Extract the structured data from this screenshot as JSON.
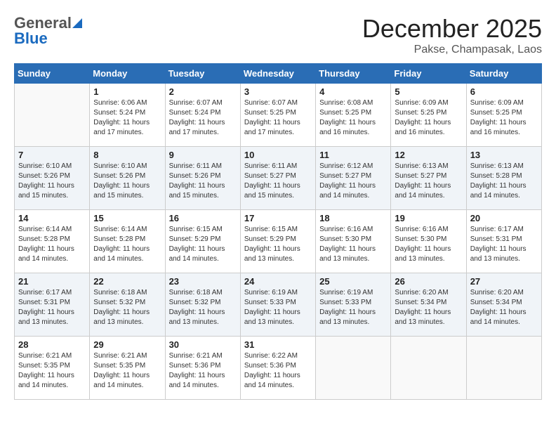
{
  "header": {
    "logo_general": "General",
    "logo_blue": "Blue",
    "title": "December 2025",
    "location": "Pakse, Champasak, Laos"
  },
  "days_of_week": [
    "Sunday",
    "Monday",
    "Tuesday",
    "Wednesday",
    "Thursday",
    "Friday",
    "Saturday"
  ],
  "weeks": [
    [
      {
        "day": "",
        "empty": true
      },
      {
        "day": "1",
        "sunrise": "6:06 AM",
        "sunset": "5:24 PM",
        "daylight": "11 hours and 17 minutes."
      },
      {
        "day": "2",
        "sunrise": "6:07 AM",
        "sunset": "5:24 PM",
        "daylight": "11 hours and 17 minutes."
      },
      {
        "day": "3",
        "sunrise": "6:07 AM",
        "sunset": "5:25 PM",
        "daylight": "11 hours and 17 minutes."
      },
      {
        "day": "4",
        "sunrise": "6:08 AM",
        "sunset": "5:25 PM",
        "daylight": "11 hours and 16 minutes."
      },
      {
        "day": "5",
        "sunrise": "6:09 AM",
        "sunset": "5:25 PM",
        "daylight": "11 hours and 16 minutes."
      },
      {
        "day": "6",
        "sunrise": "6:09 AM",
        "sunset": "5:25 PM",
        "daylight": "11 hours and 16 minutes."
      }
    ],
    [
      {
        "day": "7",
        "sunrise": "6:10 AM",
        "sunset": "5:26 PM",
        "daylight": "11 hours and 15 minutes."
      },
      {
        "day": "8",
        "sunrise": "6:10 AM",
        "sunset": "5:26 PM",
        "daylight": "11 hours and 15 minutes."
      },
      {
        "day": "9",
        "sunrise": "6:11 AM",
        "sunset": "5:26 PM",
        "daylight": "11 hours and 15 minutes."
      },
      {
        "day": "10",
        "sunrise": "6:11 AM",
        "sunset": "5:27 PM",
        "daylight": "11 hours and 15 minutes."
      },
      {
        "day": "11",
        "sunrise": "6:12 AM",
        "sunset": "5:27 PM",
        "daylight": "11 hours and 14 minutes."
      },
      {
        "day": "12",
        "sunrise": "6:13 AM",
        "sunset": "5:27 PM",
        "daylight": "11 hours and 14 minutes."
      },
      {
        "day": "13",
        "sunrise": "6:13 AM",
        "sunset": "5:28 PM",
        "daylight": "11 hours and 14 minutes."
      }
    ],
    [
      {
        "day": "14",
        "sunrise": "6:14 AM",
        "sunset": "5:28 PM",
        "daylight": "11 hours and 14 minutes."
      },
      {
        "day": "15",
        "sunrise": "6:14 AM",
        "sunset": "5:28 PM",
        "daylight": "11 hours and 14 minutes."
      },
      {
        "day": "16",
        "sunrise": "6:15 AM",
        "sunset": "5:29 PM",
        "daylight": "11 hours and 14 minutes."
      },
      {
        "day": "17",
        "sunrise": "6:15 AM",
        "sunset": "5:29 PM",
        "daylight": "11 hours and 13 minutes."
      },
      {
        "day": "18",
        "sunrise": "6:16 AM",
        "sunset": "5:30 PM",
        "daylight": "11 hours and 13 minutes."
      },
      {
        "day": "19",
        "sunrise": "6:16 AM",
        "sunset": "5:30 PM",
        "daylight": "11 hours and 13 minutes."
      },
      {
        "day": "20",
        "sunrise": "6:17 AM",
        "sunset": "5:31 PM",
        "daylight": "11 hours and 13 minutes."
      }
    ],
    [
      {
        "day": "21",
        "sunrise": "6:17 AM",
        "sunset": "5:31 PM",
        "daylight": "11 hours and 13 minutes."
      },
      {
        "day": "22",
        "sunrise": "6:18 AM",
        "sunset": "5:32 PM",
        "daylight": "11 hours and 13 minutes."
      },
      {
        "day": "23",
        "sunrise": "6:18 AM",
        "sunset": "5:32 PM",
        "daylight": "11 hours and 13 minutes."
      },
      {
        "day": "24",
        "sunrise": "6:19 AM",
        "sunset": "5:33 PM",
        "daylight": "11 hours and 13 minutes."
      },
      {
        "day": "25",
        "sunrise": "6:19 AM",
        "sunset": "5:33 PM",
        "daylight": "11 hours and 13 minutes."
      },
      {
        "day": "26",
        "sunrise": "6:20 AM",
        "sunset": "5:34 PM",
        "daylight": "11 hours and 13 minutes."
      },
      {
        "day": "27",
        "sunrise": "6:20 AM",
        "sunset": "5:34 PM",
        "daylight": "11 hours and 14 minutes."
      }
    ],
    [
      {
        "day": "28",
        "sunrise": "6:21 AM",
        "sunset": "5:35 PM",
        "daylight": "11 hours and 14 minutes."
      },
      {
        "day": "29",
        "sunrise": "6:21 AM",
        "sunset": "5:35 PM",
        "daylight": "11 hours and 14 minutes."
      },
      {
        "day": "30",
        "sunrise": "6:21 AM",
        "sunset": "5:36 PM",
        "daylight": "11 hours and 14 minutes."
      },
      {
        "day": "31",
        "sunrise": "6:22 AM",
        "sunset": "5:36 PM",
        "daylight": "11 hours and 14 minutes."
      },
      {
        "day": "",
        "empty": true
      },
      {
        "day": "",
        "empty": true
      },
      {
        "day": "",
        "empty": true
      }
    ]
  ]
}
